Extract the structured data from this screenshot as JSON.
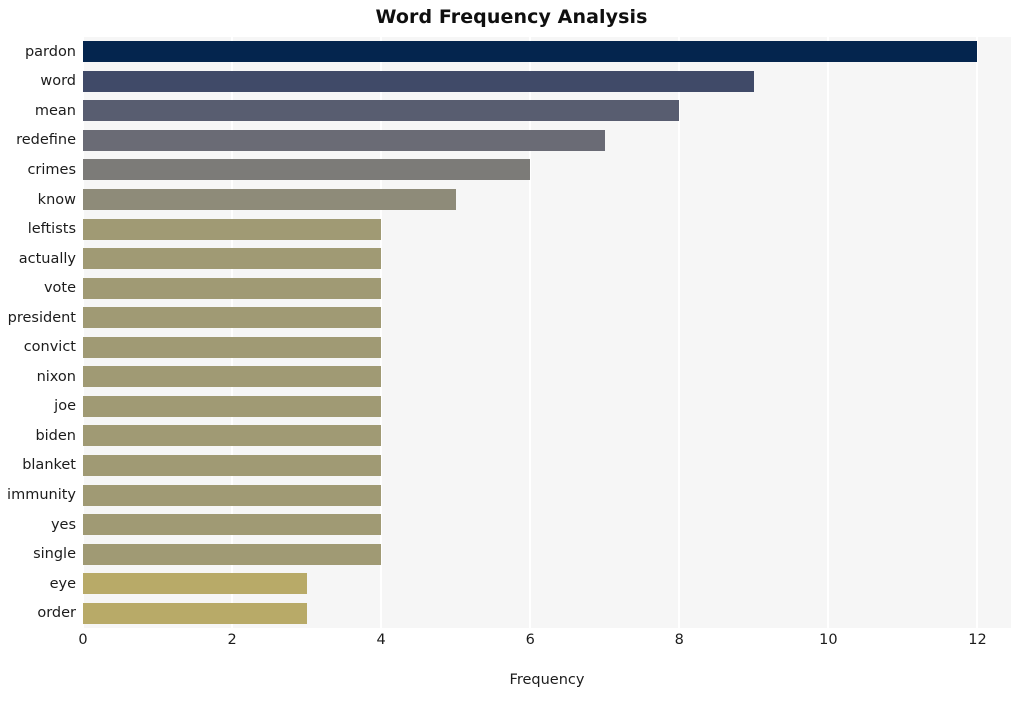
{
  "chart_data": {
    "type": "bar",
    "orientation": "horizontal",
    "title": "Word Frequency Analysis",
    "xlabel": "Frequency",
    "ylabel": "",
    "xlim": [
      0,
      12.45
    ],
    "xticks": [
      0,
      2,
      4,
      6,
      8,
      10,
      12
    ],
    "xticklabels": [
      "0",
      "2",
      "4",
      "6",
      "8",
      "10",
      "12"
    ],
    "grid": true,
    "grid_axis": "x",
    "grid_color": "#ffffff",
    "plot_background": "#f6f6f6",
    "legend": false,
    "categories": [
      "pardon",
      "word",
      "mean",
      "redefine",
      "crimes",
      "know",
      "leftists",
      "actually",
      "vote",
      "president",
      "convict",
      "nixon",
      "joe",
      "biden",
      "blanket",
      "immunity",
      "yes",
      "single",
      "eye",
      "order"
    ],
    "values": [
      12,
      9,
      8,
      7,
      6,
      5,
      4,
      4,
      4,
      4,
      4,
      4,
      4,
      4,
      4,
      4,
      4,
      4,
      3,
      3
    ],
    "bar_colors": [
      "#04254e",
      "#404a68",
      "#585d70",
      "#6a6b75",
      "#7c7b78",
      "#8e8b79",
      "#a09a74",
      "#a09a74",
      "#a09a74",
      "#a09a74",
      "#a09a74",
      "#a09a74",
      "#a09a74",
      "#a09a74",
      "#a09a74",
      "#a09a74",
      "#a09a74",
      "#a09a74",
      "#b8aa68",
      "#b8aa68"
    ]
  },
  "title": "Word Frequency Analysis",
  "axes": {
    "x_title": "Frequency"
  }
}
